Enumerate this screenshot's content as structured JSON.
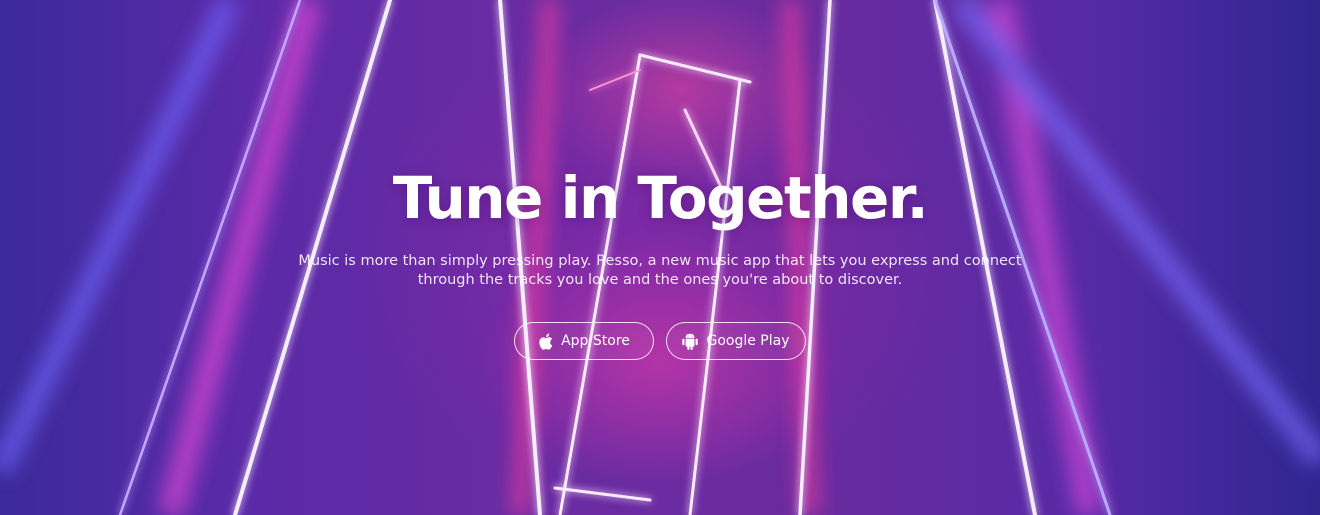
{
  "hero": {
    "title": "Tune in Together.",
    "subtitle_line1": "Music is more than simply pressing play. Resso, a new music app that lets you express and connect",
    "subtitle_line2": "through the tracks you love and the ones you're about to discover."
  },
  "buttons": {
    "app_store": {
      "label": "App Store",
      "icon": "apple-icon"
    },
    "google_play": {
      "label": "Google Play",
      "icon": "android-icon"
    }
  },
  "colors": {
    "background_purple": "#5a2aa8",
    "neon_pink": "#ff4fb0",
    "neon_white": "#f4eaff",
    "text": "#ffffff"
  }
}
